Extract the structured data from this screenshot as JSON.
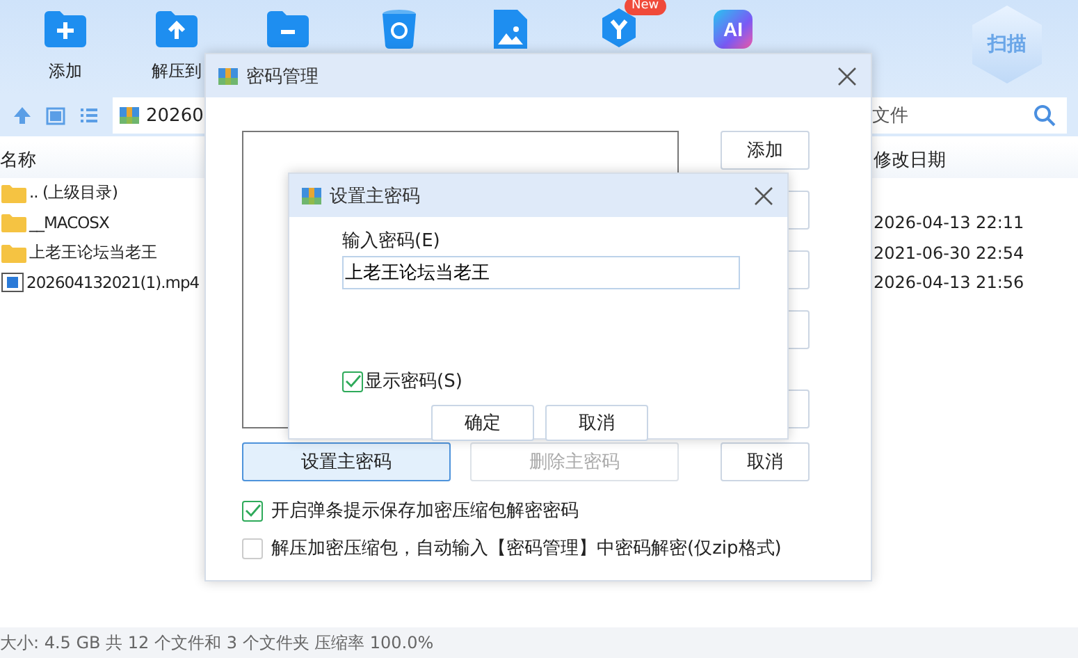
{
  "toolbar": [
    {
      "kind": "add",
      "label": "添加"
    },
    {
      "kind": "extract",
      "label": "解压到"
    },
    {
      "kind": "remove"
    },
    {
      "kind": "recycle"
    },
    {
      "kind": "image"
    },
    {
      "kind": "hexagon",
      "badge": "New"
    },
    {
      "kind": "ai",
      "text": "AI"
    }
  ],
  "scan_button": {
    "label": "扫描"
  },
  "address": {
    "path": "20260"
  },
  "search": {
    "placeholder": "文件"
  },
  "columns": [
    "名称",
    "修改日期"
  ],
  "files": [
    {
      "kind": "folder",
      "name": ".. (上级目录)"
    },
    {
      "kind": "folder",
      "name": "__MACOSX",
      "modified": "2026-04-13 22:11"
    },
    {
      "kind": "folder",
      "name": "上老王论坛当老王",
      "modified": "2021-06-30 22:54"
    },
    {
      "kind": "video",
      "name": "202604132021(1).mp4",
      "modified": "2026-04-13 21:56"
    }
  ],
  "status_bar": "大小: 4.5 GB 共 12 个文件和 3 个文件夹 压缩率 100.0%",
  "password_manager": {
    "title": "密码管理",
    "add_button": "添加",
    "bottom_buttons": [
      {
        "label": "设置主密码",
        "focused": true,
        "disabled": false
      },
      {
        "label": "删除主密码",
        "focused": false,
        "disabled": true
      }
    ],
    "cancel_button": "取消",
    "options": [
      {
        "label": "开启弹条提示保存加密压缩包解密密码",
        "checked": true
      },
      {
        "label": "解压加密压缩包，自动输入【密码管理】中密码解密(仅zip格式)",
        "checked": false
      }
    ]
  },
  "master_password_dialog": {
    "title": "设置主密码",
    "field_label": "输入密码(E)",
    "value": "上老王论坛当老王",
    "show_password": {
      "label": "显示密码(S)",
      "checked": true
    },
    "buttons": [
      "确定",
      "取消"
    ]
  }
}
